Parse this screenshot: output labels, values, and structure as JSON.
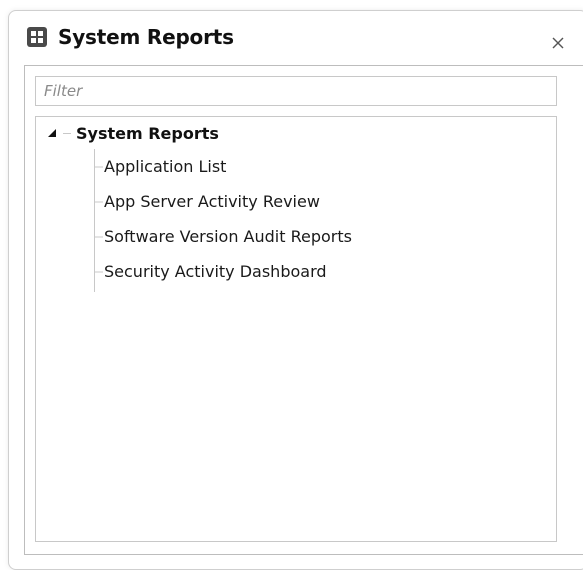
{
  "dialog": {
    "title": "System Reports",
    "title_icon": "grid-report-icon",
    "close_icon": "close-icon"
  },
  "filter": {
    "placeholder": "Filter",
    "value": ""
  },
  "tree": {
    "root": {
      "label": "System Reports",
      "expanded": true,
      "children": [
        {
          "label": "Application List"
        },
        {
          "label": "App Server Activity Review"
        },
        {
          "label": "Software Version Audit Reports"
        },
        {
          "label": "Security Activity Dashboard"
        }
      ]
    }
  },
  "colors": {
    "title_icon_bg": "#4a4a4a",
    "border": "#bdbdbd",
    "tree_line": "#c8c8c8"
  }
}
